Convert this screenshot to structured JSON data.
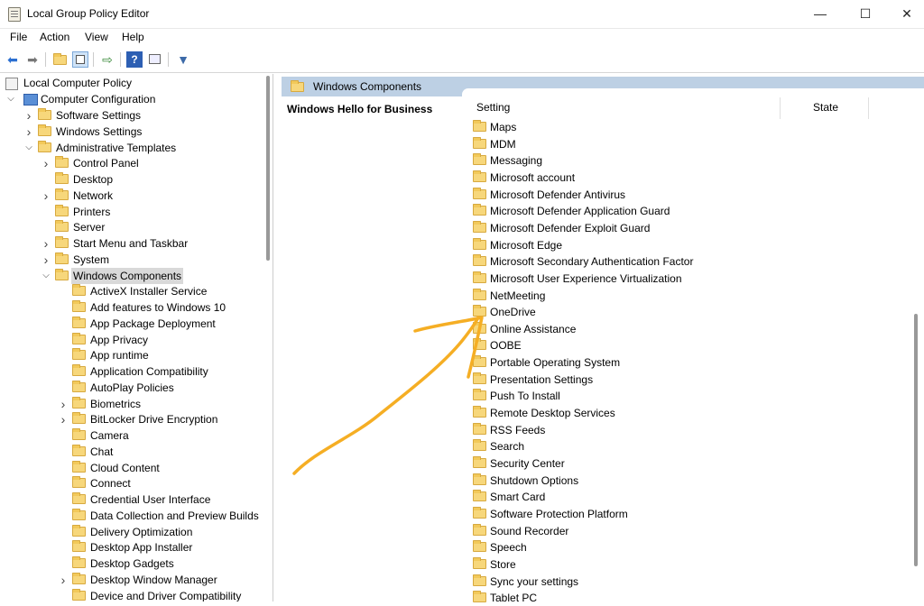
{
  "window": {
    "title": "Local Group Policy Editor",
    "controls": {
      "minimize": "—",
      "maximize": "☐",
      "close": "✕"
    }
  },
  "menu": [
    "File",
    "Action",
    "View",
    "Help"
  ],
  "toolbar_icons": [
    "back-arrow-icon",
    "forward-arrow-icon",
    "up-folder-icon",
    "show-hide-tree-icon",
    "export-list-icon",
    "help-icon",
    "properties-icon",
    "filter-icon"
  ],
  "tree": {
    "root": "Local Computer Policy",
    "computer_configuration": "Computer Configuration",
    "items": [
      {
        "label": "Software Settings",
        "level": 1,
        "expander": "collapsed"
      },
      {
        "label": "Windows Settings",
        "level": 1,
        "expander": "collapsed"
      },
      {
        "label": "Administrative Templates",
        "level": 1,
        "expander": "expanded"
      },
      {
        "label": "Control Panel",
        "level": 2,
        "expander": "collapsed"
      },
      {
        "label": "Desktop",
        "level": 2,
        "expander": "none"
      },
      {
        "label": "Network",
        "level": 2,
        "expander": "collapsed"
      },
      {
        "label": "Printers",
        "level": 2,
        "expander": "none"
      },
      {
        "label": "Server",
        "level": 2,
        "expander": "none"
      },
      {
        "label": "Start Menu and Taskbar",
        "level": 2,
        "expander": "collapsed"
      },
      {
        "label": "System",
        "level": 2,
        "expander": "collapsed"
      },
      {
        "label": "Windows Components",
        "level": 2,
        "expander": "expanded",
        "selected": true
      },
      {
        "label": "ActiveX Installer Service",
        "level": 3,
        "expander": "none"
      },
      {
        "label": "Add features to Windows 10",
        "level": 3,
        "expander": "none"
      },
      {
        "label": "App Package Deployment",
        "level": 3,
        "expander": "none"
      },
      {
        "label": "App Privacy",
        "level": 3,
        "expander": "none"
      },
      {
        "label": "App runtime",
        "level": 3,
        "expander": "none"
      },
      {
        "label": "Application Compatibility",
        "level": 3,
        "expander": "none"
      },
      {
        "label": "AutoPlay Policies",
        "level": 3,
        "expander": "none"
      },
      {
        "label": "Biometrics",
        "level": 3,
        "expander": "collapsed"
      },
      {
        "label": "BitLocker Drive Encryption",
        "level": 3,
        "expander": "collapsed"
      },
      {
        "label": "Camera",
        "level": 3,
        "expander": "none"
      },
      {
        "label": "Chat",
        "level": 3,
        "expander": "none"
      },
      {
        "label": "Cloud Content",
        "level": 3,
        "expander": "none"
      },
      {
        "label": "Connect",
        "level": 3,
        "expander": "none"
      },
      {
        "label": "Credential User Interface",
        "level": 3,
        "expander": "none"
      },
      {
        "label": "Data Collection and Preview Builds",
        "level": 3,
        "expander": "none"
      },
      {
        "label": "Delivery Optimization",
        "level": 3,
        "expander": "none"
      },
      {
        "label": "Desktop App Installer",
        "level": 3,
        "expander": "none"
      },
      {
        "label": "Desktop Gadgets",
        "level": 3,
        "expander": "none"
      },
      {
        "label": "Desktop Window Manager",
        "level": 3,
        "expander": "collapsed"
      },
      {
        "label": "Device and Driver Compatibility",
        "level": 3,
        "expander": "none"
      }
    ]
  },
  "right": {
    "header": "Windows Components",
    "extended_title": "Windows Hello for Business",
    "columns": {
      "setting": "Setting",
      "state": "State"
    },
    "items": [
      "Maps",
      "MDM",
      "Messaging",
      "Microsoft account",
      "Microsoft Defender Antivirus",
      "Microsoft Defender Application Guard",
      "Microsoft Defender Exploit Guard",
      "Microsoft Edge",
      "Microsoft Secondary Authentication Factor",
      "Microsoft User Experience Virtualization",
      "NetMeeting",
      "OneDrive",
      "Online Assistance",
      "OOBE",
      "Portable Operating System",
      "Presentation Settings",
      "Push To Install",
      "Remote Desktop Services",
      "RSS Feeds",
      "Search",
      "Security Center",
      "Shutdown Options",
      "Smart Card",
      "Software Protection Platform",
      "Sound Recorder",
      "Speech",
      "Store",
      "Sync your settings",
      "Tablet PC"
    ]
  },
  "colors": {
    "header_band": "#bdd0e4",
    "annotation": "#f5ae24",
    "selection": "#d9d9d9"
  }
}
